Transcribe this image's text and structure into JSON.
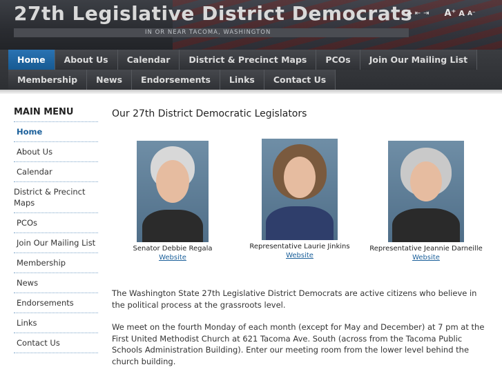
{
  "site": {
    "title": "27th Legislative District Democrats",
    "tagline": "IN OR NEAR TACOMA, WASHINGTON",
    "tools": [
      "◆",
      "⇤",
      "⇥",
      "A⁺",
      "A",
      "A⁻"
    ]
  },
  "nav": {
    "row1": [
      "Home",
      "About Us",
      "Calendar",
      "District & Precinct Maps",
      "PCOs",
      "Join Our Mailing List"
    ],
    "row2": [
      "Membership",
      "News",
      "Endorsements",
      "Links",
      "Contact Us"
    ]
  },
  "sidebar": {
    "heading": "MAIN MENU",
    "items": [
      "Home",
      "About Us",
      "Calendar",
      "District & Precinct Maps",
      "PCOs",
      "Join Our Mailing List",
      "Membership",
      "News",
      "Endorsements",
      "Links",
      "Contact Us"
    ]
  },
  "main": {
    "title": "Our 27th District Democratic Legislators",
    "legislators": [
      {
        "name": "Senator Debbie Regala",
        "link": "Website"
      },
      {
        "name": "Representative Laurie Jinkins",
        "link": "Website"
      },
      {
        "name": "Representative Jeannie Darneille",
        "link": "Website"
      }
    ],
    "paragraphs": [
      "The Washington State 27th Legislative District Democrats are active citizens who believe in the political process at the grassroots level.",
      "We meet on the fourth Monday of each month (except for May and December) at 7 pm at the First United Methodist Church at 621 Tacoma Ave. South (across from the Tacoma Public Schools Administration Building).  Enter our meeting room from the lower level behind the church building."
    ]
  },
  "colors": {
    "accent": "#1a5f9a",
    "nav_active": "#2a73b3",
    "header_bg": "#2a2c31"
  }
}
